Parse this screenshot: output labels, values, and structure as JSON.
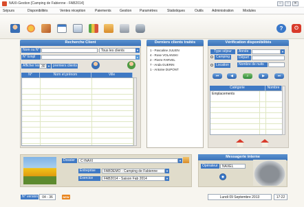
{
  "window": {
    "title": "NAXI-Gestion [Camping de Fabienne - FAB2014]",
    "minimize": "–",
    "maximize": "▫",
    "close": "✕"
  },
  "menu": [
    "Séjours",
    "Disponibilités",
    "Ventes réception",
    "Paiements",
    "Gestion",
    "Paramètres",
    "Statistiques",
    "Outils",
    "Administration",
    "Modules"
  ],
  "colors": {
    "accent": "#3f79c4",
    "header": "#4a86c8",
    "panel": "#e7e3db",
    "bottom_bar": "#e0dccb"
  },
  "recherche": {
    "header": "Recherche Client",
    "nom_label": "Nom ou N°",
    "nom_value": "",
    "filter_value": "Tous les clients",
    "emp_label": "N° Empl",
    "emp_value": "",
    "afficher_label": "Afficher les",
    "afficher_value": "30",
    "premiers_label": "premiers clients",
    "columns": [
      "N°",
      "Nom et prénom",
      "Ville"
    ]
  },
  "derniers": {
    "header": "Derniers clients traités",
    "items": [
      "1 - Pascaline JULIEN",
      "4 - Rose VOLANSKI",
      "2 - Pierre FARVEL",
      "7 - Anda GUERIN",
      "1 - Antoine DUPONT"
    ]
  },
  "verification": {
    "header": "Vérification disponibilités",
    "type_label": "Type séjour",
    "annee_label": "Année",
    "annee_value": "",
    "depart_label": "Départ",
    "depart_value": "",
    "nuits_label": "Nombre de nuits",
    "nuits_value": "",
    "camping_label": "Camping",
    "location_label": "Location",
    "categorie_header": "Catégorie",
    "nombre_header": "Nombre",
    "categorie_row": "Emplacements"
  },
  "bottom": {
    "dossier_label": "Dossier",
    "dossier_value": "C:\\NAXI",
    "entreprise_label": "Entreprise",
    "entreprise_value": "FABDEMO - Camping de Fabienne",
    "exercice_label": "Exercice",
    "exercice_value": "FAB2014 - Saison Fab 2014",
    "messagerie_header": "Messagerie interne",
    "operateur_label": "Opérateur",
    "operateur_value": "NAXEL",
    "version_label": "N° version",
    "version_value": "04 - 36",
    "new_badge": "NEW",
    "date_value": "Lundi 09 Septembre 2013",
    "time_value": "17:22"
  },
  "icons": [
    "user-icon",
    "sun-icon",
    "beach-icon",
    "calendar-icon",
    "invoice-icon",
    "chart-icon",
    "folder-icon",
    "printer-icon",
    "database-icon",
    "help-icon",
    "exit-icon"
  ]
}
